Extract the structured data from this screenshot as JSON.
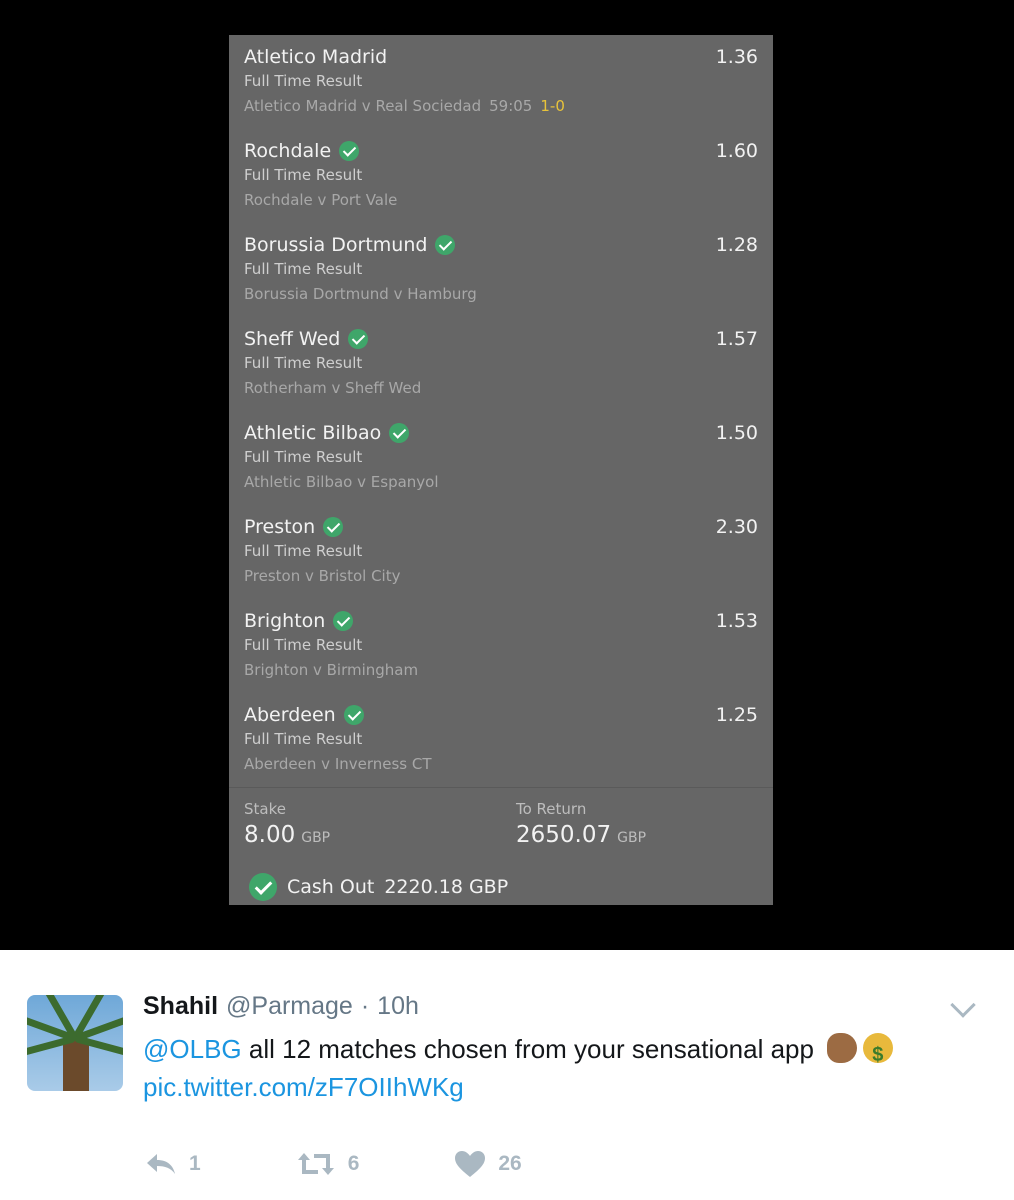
{
  "betslip": {
    "selections": [
      {
        "team": "Atletico Madrid",
        "odds": "1.36",
        "market": "Full Time Result",
        "event": "Atletico Madrid v Real Sociedad",
        "time": "59:05",
        "score": "1-0",
        "settled": false
      },
      {
        "team": "Rochdale",
        "odds": "1.60",
        "market": "Full Time Result",
        "event": "Rochdale v Port Vale",
        "settled": true
      },
      {
        "team": "Borussia Dortmund",
        "odds": "1.28",
        "market": "Full Time Result",
        "event": "Borussia Dortmund v Hamburg",
        "settled": true
      },
      {
        "team": "Sheff Wed",
        "odds": "1.57",
        "market": "Full Time Result",
        "event": "Rotherham v Sheff Wed",
        "settled": true
      },
      {
        "team": "Athletic Bilbao",
        "odds": "1.50",
        "market": "Full Time Result",
        "event": "Athletic Bilbao v Espanyol",
        "settled": true
      },
      {
        "team": "Preston",
        "odds": "2.30",
        "market": "Full Time Result",
        "event": "Preston v Bristol City",
        "settled": true
      },
      {
        "team": "Brighton",
        "odds": "1.53",
        "market": "Full Time Result",
        "event": "Brighton v Birmingham",
        "settled": true
      },
      {
        "team": "Aberdeen",
        "odds": "1.25",
        "market": "Full Time Result",
        "event": "Aberdeen v Inverness CT",
        "settled": true
      }
    ],
    "stake_label": "Stake",
    "stake_value": "8.00",
    "stake_currency": "GBP",
    "return_label": "To Return",
    "return_value": "2650.07",
    "return_currency": "GBP",
    "cashout_label": "Cash Out",
    "cashout_value": "2220.18 GBP"
  },
  "tweet": {
    "display_name": "Shahil",
    "handle": "@Parmage",
    "separator": "·",
    "time": "10h",
    "mention": "@OLBG",
    "text": " all 12 matches chosen from your sensational app",
    "link": "pic.twitter.com/zF7OIIhWKg",
    "emojis": [
      "flexed-biceps",
      "money-bag"
    ],
    "reply_count": "1",
    "retweet_count": "6",
    "like_count": "26"
  },
  "colors": {
    "check_green": "#3fa66a",
    "score_yellow": "#e8c33a",
    "link_blue": "#1b95e0"
  }
}
